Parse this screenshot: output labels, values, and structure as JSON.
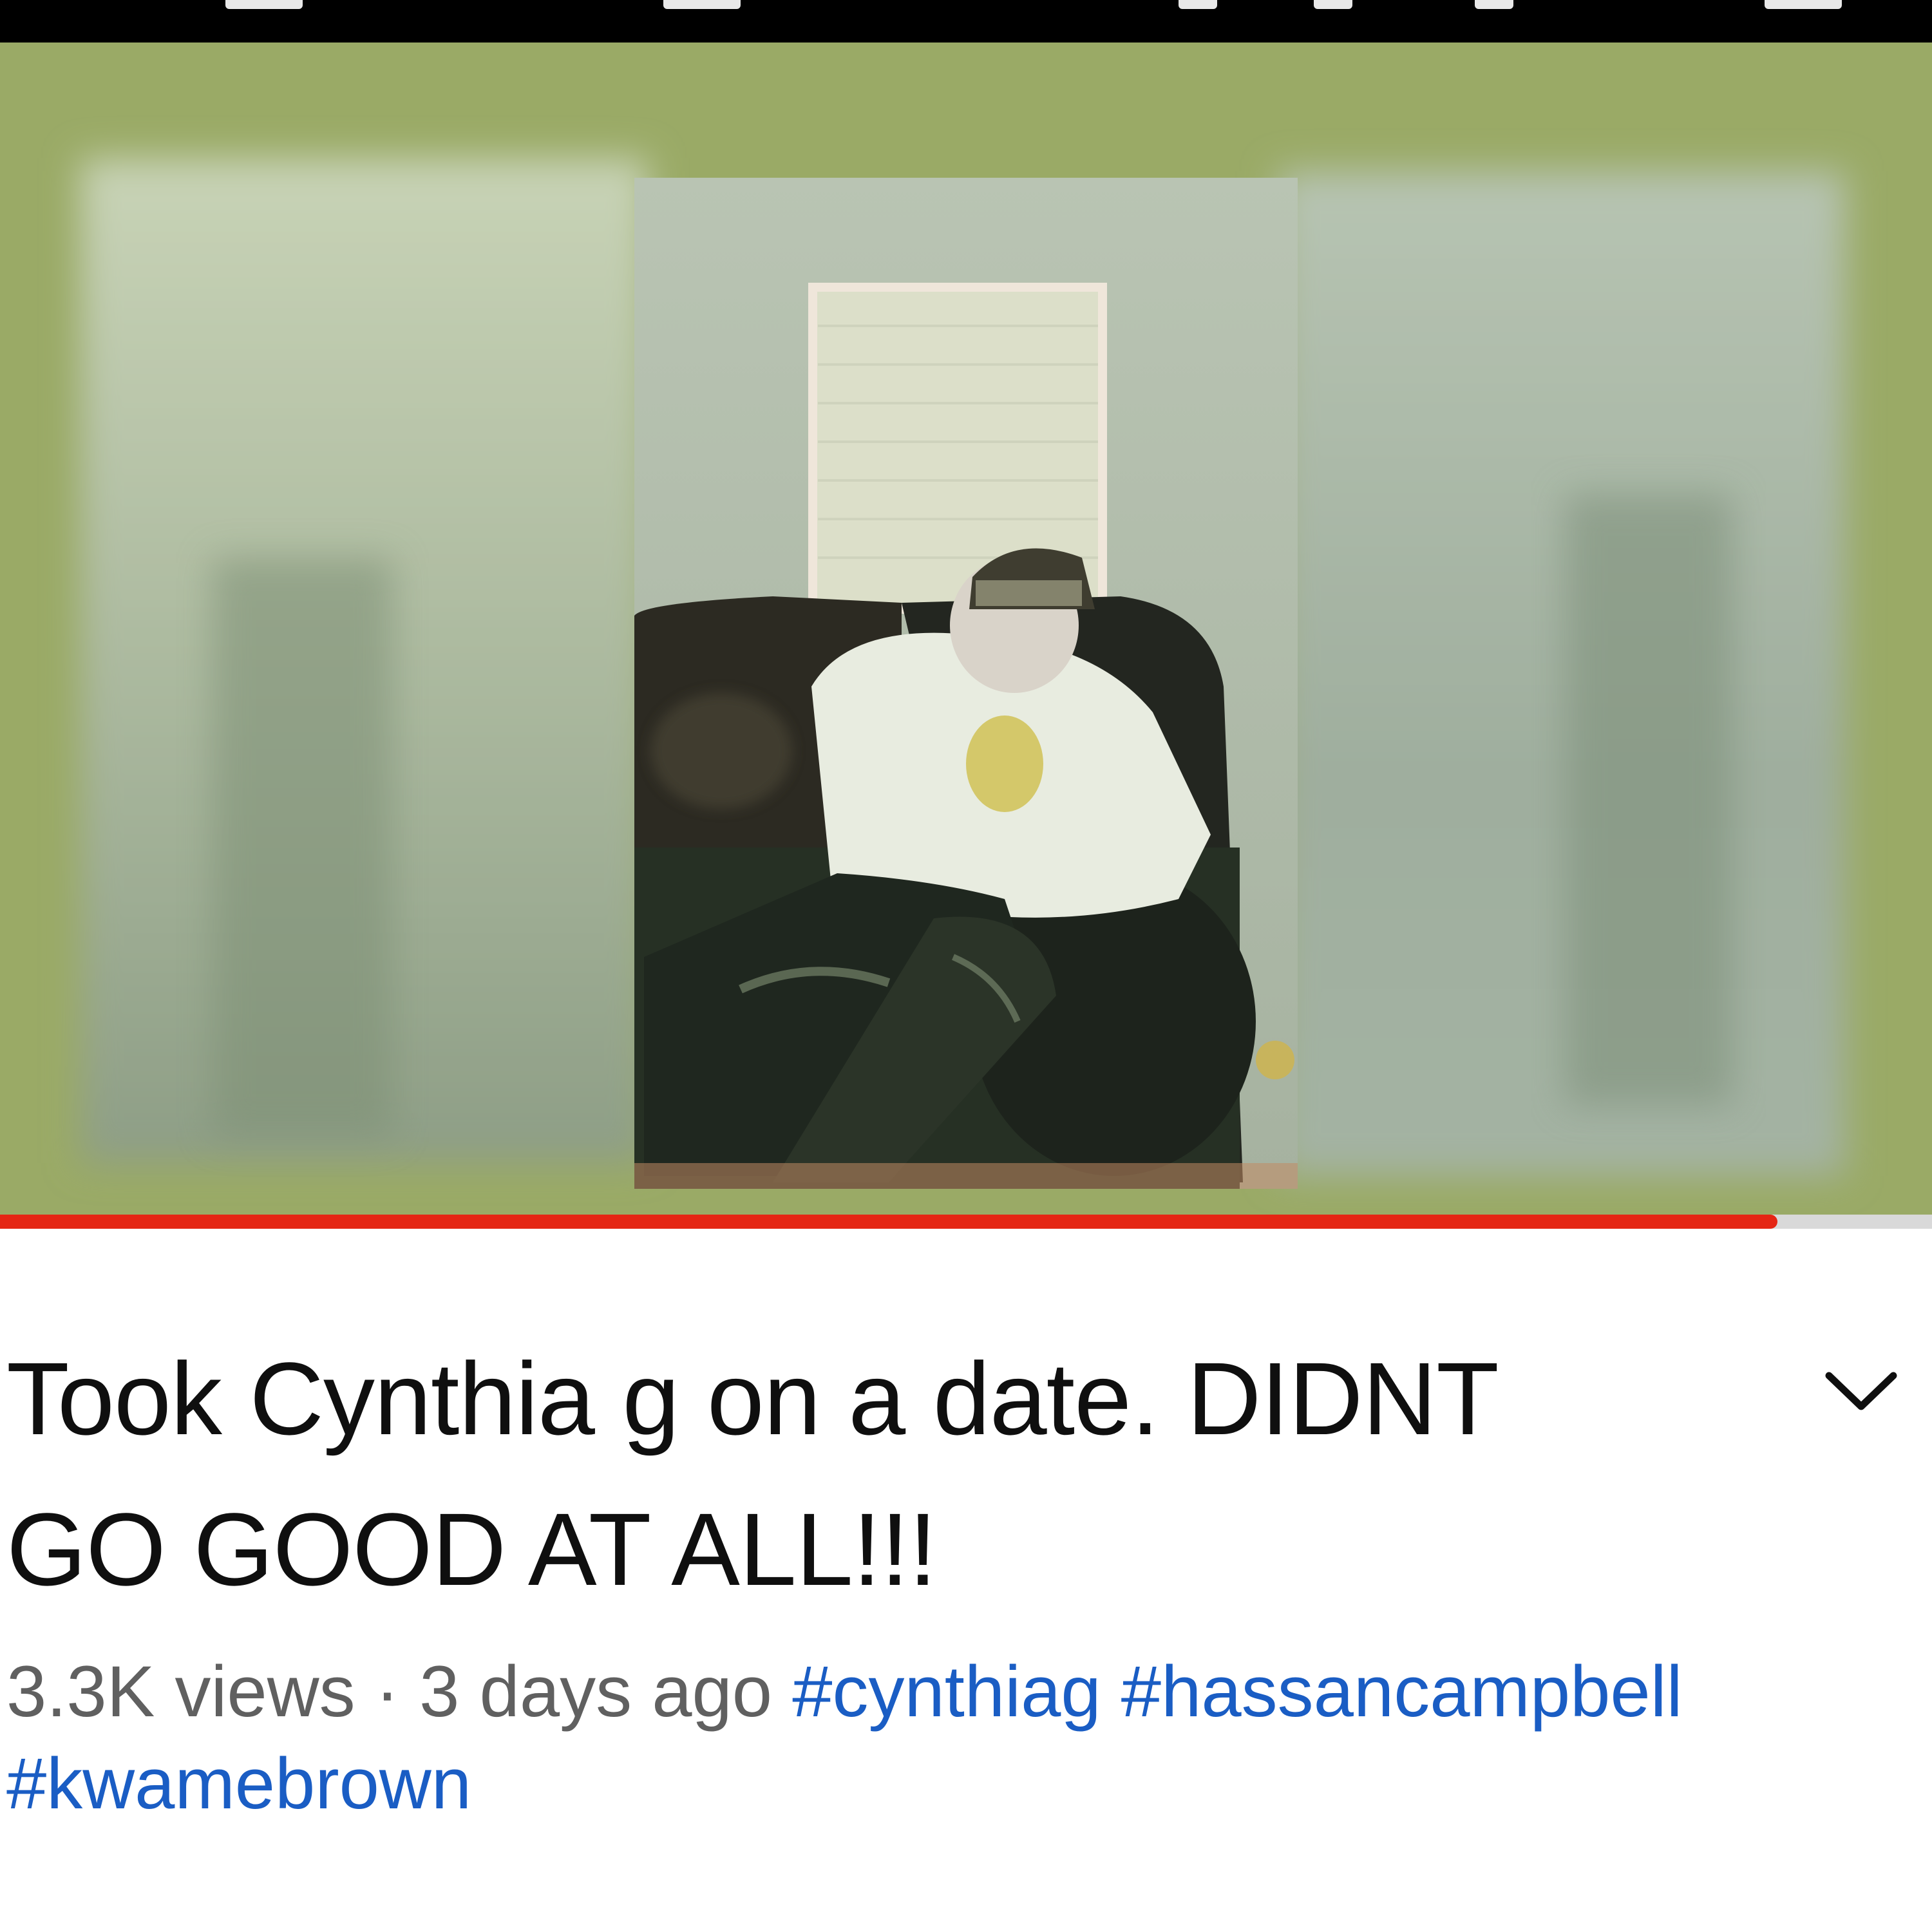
{
  "video": {
    "title": "Took Cynthia g on a date. DIDNT GO GOOD AT ALL!!!",
    "views": "3.3K views",
    "separator": "·",
    "age": "3 days ago",
    "hashtags": [
      "#cynthiag",
      "#hassancampbell",
      "#kwamebrown"
    ],
    "progress_fraction": 0.92
  },
  "icons": {
    "expand": "chevron-down-icon"
  },
  "colors": {
    "progress": "#e52614",
    "hashtag": "#1a5dc4",
    "meta_text": "#606060",
    "title_text": "#0f0f0f",
    "player_bg": "#9aaa66"
  }
}
